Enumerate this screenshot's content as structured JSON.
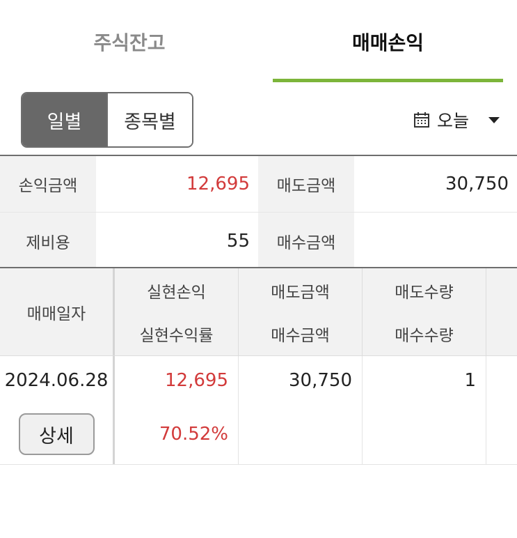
{
  "tabs": [
    {
      "label": "주식잔고",
      "active": false
    },
    {
      "label": "매매손익",
      "active": true
    }
  ],
  "accent_color": "#7cb53a",
  "profit_color": "#d23a3a",
  "segment": {
    "daily_label": "일별",
    "by_stock_label": "종목별",
    "selected": "일별"
  },
  "date_filter": {
    "icon": "calendar-icon",
    "value": "오늘"
  },
  "summary": {
    "profit_label": "손익금액",
    "profit_value": "12,695",
    "sell_label": "매도금액",
    "sell_value": "30,750",
    "fee_label": "제비용",
    "fee_value": "55",
    "buy_label": "매수금액",
    "buy_value": ""
  },
  "table": {
    "headers": {
      "date": "매매일자",
      "realized_pl": "실현손익",
      "realized_rate": "실현수익률",
      "sell_amount": "매도금액",
      "buy_amount": "매수금액",
      "sell_qty": "매도수량",
      "buy_qty": "매수수량"
    },
    "rows": [
      {
        "date": "2024.06.28",
        "detail_label": "상세",
        "realized_pl": "12,695",
        "realized_rate": "70.52%",
        "sell_amount": "30,750",
        "buy_amount": "",
        "sell_qty": "1",
        "buy_qty": ""
      }
    ]
  }
}
